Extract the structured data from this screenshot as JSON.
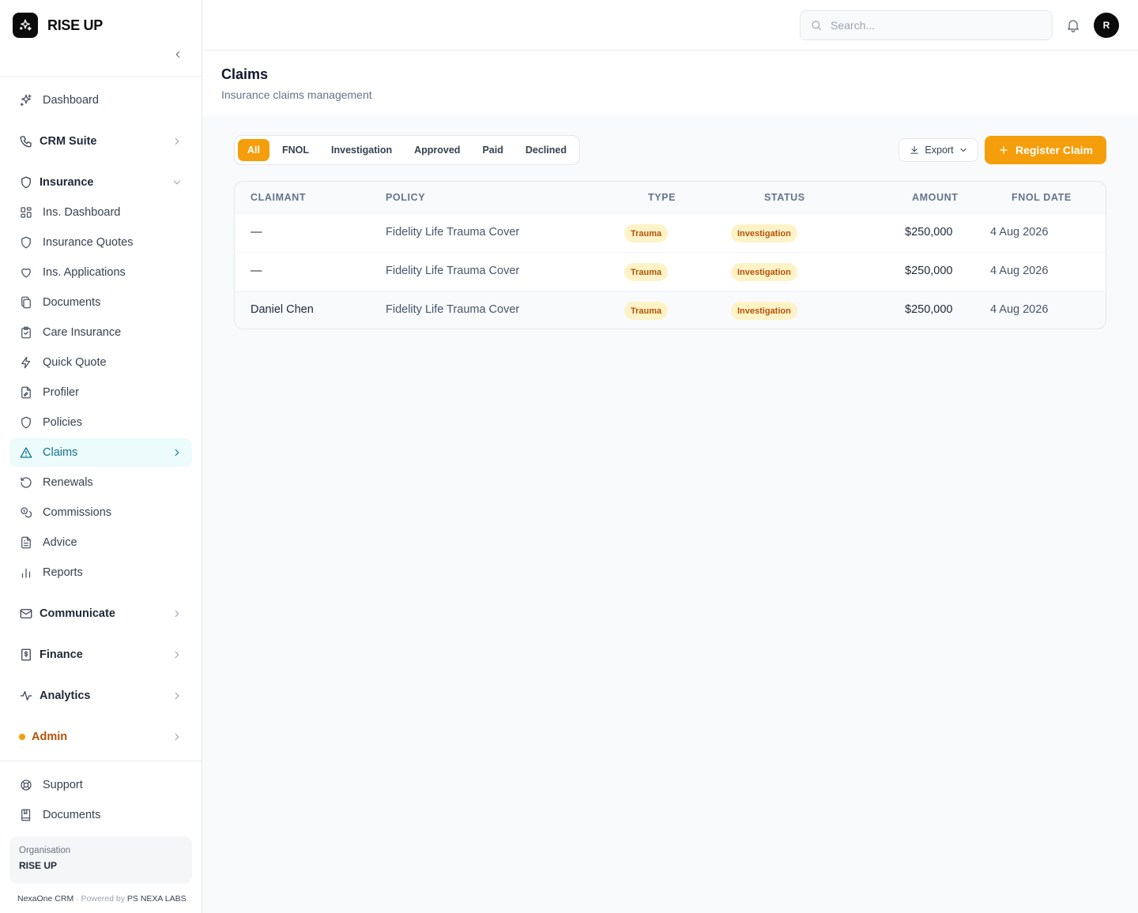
{
  "brand": {
    "name": "RISE UP"
  },
  "nav": {
    "dashboard": "Dashboard",
    "crm_suite": "CRM Suite",
    "insurance": "Insurance",
    "insurance_items": [
      {
        "label": "Ins. Dashboard",
        "icon": "grid-icon"
      },
      {
        "label": "Insurance Quotes",
        "icon": "shield-icon"
      },
      {
        "label": "Ins. Applications",
        "icon": "heart-icon"
      },
      {
        "label": "Documents",
        "icon": "copy-icon"
      },
      {
        "label": "Care Insurance",
        "icon": "clipboard-check-icon"
      },
      {
        "label": "Quick Quote",
        "icon": "lightning-icon"
      },
      {
        "label": "Profiler",
        "icon": "file-edit-icon"
      },
      {
        "label": "Policies",
        "icon": "shield-icon"
      },
      {
        "label": "Claims",
        "icon": "alert-triangle-icon"
      },
      {
        "label": "Renewals",
        "icon": "rotate-icon"
      },
      {
        "label": "Commissions",
        "icon": "coins-icon"
      },
      {
        "label": "Advice",
        "icon": "file-text-icon"
      },
      {
        "label": "Reports",
        "icon": "bar-chart-icon"
      }
    ],
    "communicate": "Communicate",
    "finance": "Finance",
    "analytics": "Analytics",
    "admin": "Admin",
    "support": "Support",
    "documents": "Documents"
  },
  "org": {
    "label": "Organisation",
    "name": "RISE UP"
  },
  "footer": {
    "product": "NexaOne CRM",
    "separator": "·",
    "powered_by": "Powered by",
    "company": "PS NEXA LABS"
  },
  "topbar": {
    "search_placeholder": "Search...",
    "avatar_initial": "R"
  },
  "page": {
    "title": "Claims",
    "subtitle": "Insurance claims management"
  },
  "filters": [
    "All",
    "FNOL",
    "Investigation",
    "Approved",
    "Paid",
    "Declined"
  ],
  "actions": {
    "export": "Export",
    "register": "Register Claim"
  },
  "table": {
    "columns": [
      "CLAIMANT",
      "POLICY",
      "TYPE",
      "STATUS",
      "AMOUNT",
      "FNOL DATE"
    ],
    "rows": [
      {
        "claimant": "—",
        "policy": "Fidelity Life Trauma Cover",
        "type": "Trauma",
        "status": "Investigation",
        "amount": "$250,000",
        "fnol_date": "4 Aug 2026"
      },
      {
        "claimant": "—",
        "policy": "Fidelity Life Trauma Cover",
        "type": "Trauma",
        "status": "Investigation",
        "amount": "$250,000",
        "fnol_date": "4 Aug 2026"
      },
      {
        "claimant": "Daniel Chen",
        "policy": "Fidelity Life Trauma Cover",
        "type": "Trauma",
        "status": "Investigation",
        "amount": "$250,000",
        "fnol_date": "4 Aug 2026"
      }
    ]
  },
  "colors": {
    "accent": "#f59e0b",
    "active_nav_bg": "#ecfbfc",
    "active_nav_text": "#0e7490",
    "badge_bg": "#fef3c7",
    "badge_text": "#b45309"
  }
}
